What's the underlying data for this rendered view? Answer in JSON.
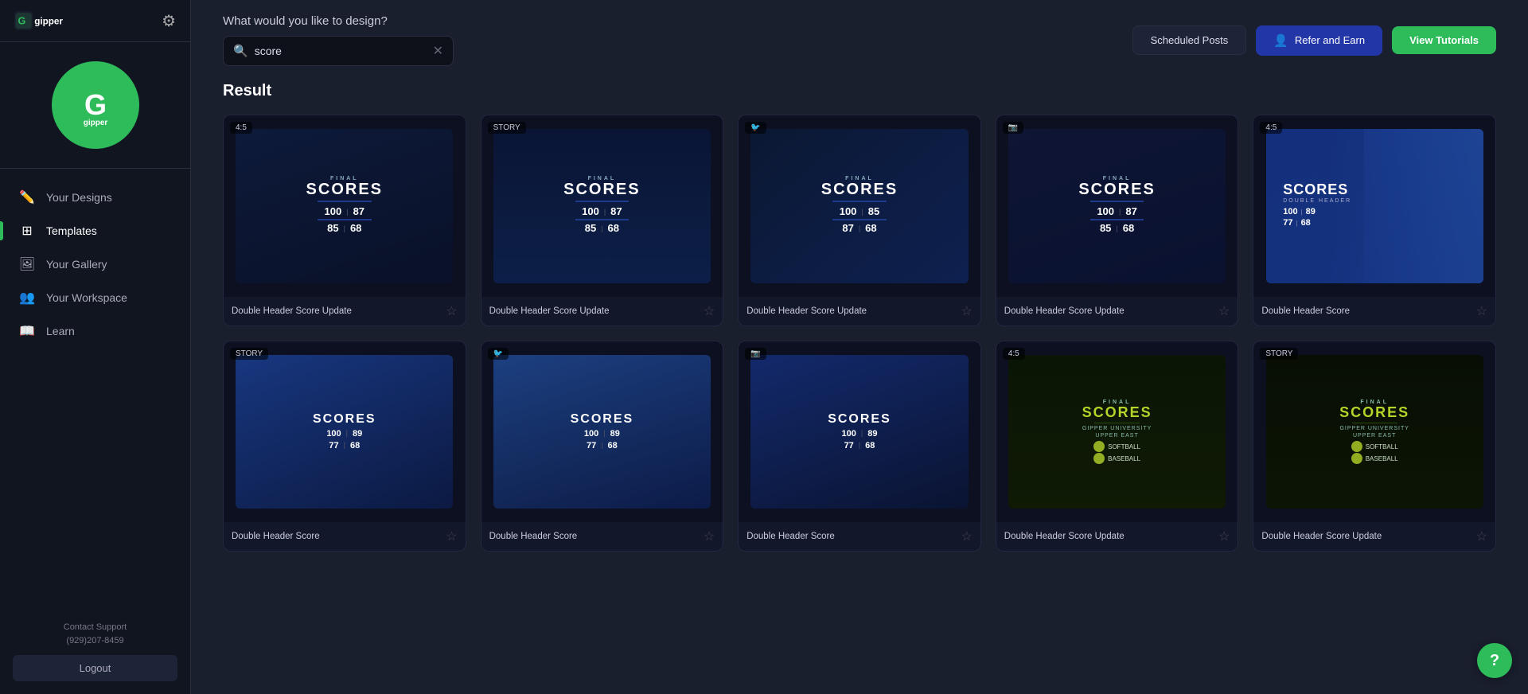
{
  "app": {
    "name": "Gipper"
  },
  "sidebar": {
    "nav_items": [
      {
        "id": "your-designs",
        "label": "Your Designs",
        "icon": "pencil"
      },
      {
        "id": "templates",
        "label": "Templates",
        "icon": "template",
        "active": true
      },
      {
        "id": "your-gallery",
        "label": "Your Gallery",
        "icon": "gallery"
      },
      {
        "id": "your-workspace",
        "label": "Your Workspace",
        "icon": "workspace"
      },
      {
        "id": "learn",
        "label": "Learn",
        "icon": "book"
      }
    ],
    "contact_support_label": "Contact Support",
    "phone": "(929)207-8459",
    "logout_label": "Logout"
  },
  "header": {
    "search_question": "What would you like to design?",
    "search_placeholder": "score",
    "search_value": "score",
    "scheduled_posts_label": "Scheduled Posts",
    "refer_earn_label": "Refer and Earn",
    "view_tutorials_label": "View Tutorials"
  },
  "results": {
    "title": "Result",
    "cards": [
      {
        "id": "card-1",
        "badge": "4:5",
        "badge_type": "ratio",
        "title": "Double Header Score Update",
        "style": "dark-blue",
        "scores": [
          [
            "100",
            "87"
          ],
          [
            "85",
            "68"
          ]
        ]
      },
      {
        "id": "card-2",
        "badge": "STORY",
        "badge_type": "story",
        "title": "Double Header Score Update",
        "style": "story-blue",
        "scores": [
          [
            "100",
            "87"
          ],
          [
            "85",
            "68"
          ]
        ]
      },
      {
        "id": "card-3",
        "badge": "🐦",
        "badge_type": "twitter",
        "title": "Double Header Score Update",
        "style": "twitter-navy",
        "scores": [
          [
            "100",
            "85"
          ],
          [
            "87",
            "68"
          ]
        ]
      },
      {
        "id": "card-4",
        "badge": "📷",
        "badge_type": "instagram",
        "title": "Double Header Score Update",
        "style": "instagram-dark",
        "scores": [
          [
            "100",
            "87"
          ],
          [
            "85",
            "68"
          ]
        ]
      },
      {
        "id": "card-5",
        "badge": "4:5",
        "badge_type": "ratio",
        "title": "Double Header Score",
        "style": "photo-sports",
        "scores": [
          [
            "100",
            "89"
          ],
          [
            "77",
            "68"
          ]
        ]
      },
      {
        "id": "card-6",
        "badge": "STORY",
        "badge_type": "story",
        "title": "Double Header Score",
        "style": "story-action",
        "scores": [
          [
            "100",
            "89"
          ],
          [
            "77",
            "68"
          ]
        ]
      },
      {
        "id": "card-7",
        "badge": "🐦",
        "badge_type": "twitter",
        "title": "Double Header Score",
        "style": "twitter-action",
        "scores": [
          [
            "100",
            "89"
          ],
          [
            "77",
            "68"
          ]
        ]
      },
      {
        "id": "card-8",
        "badge": "📷",
        "badge_type": "instagram",
        "title": "Double Header Score",
        "style": "instagram-action",
        "scores": [
          [
            "100",
            "89"
          ],
          [
            "77",
            "68"
          ]
        ]
      },
      {
        "id": "card-9",
        "badge": "4:5",
        "badge_type": "ratio",
        "title": "Double Header Score Update",
        "style": "green-yellow",
        "scores": []
      },
      {
        "id": "card-10",
        "badge": "STORY",
        "badge_type": "story",
        "title": "Double Header Score Update",
        "style": "green-yellow-story",
        "scores": []
      }
    ]
  }
}
